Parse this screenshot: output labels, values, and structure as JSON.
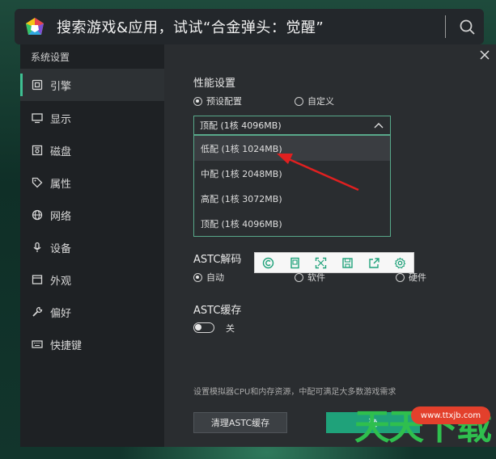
{
  "search": {
    "text": "搜索游戏&应用，试试“合金弹头：觉醒”"
  },
  "dialog": {
    "title": "系统设置"
  },
  "sidebar": {
    "items": [
      {
        "label": "引擎",
        "icon": "cpu-icon",
        "active": true
      },
      {
        "label": "显示",
        "icon": "monitor-icon",
        "active": false
      },
      {
        "label": "磁盘",
        "icon": "disk-icon",
        "active": false
      },
      {
        "label": "属性",
        "icon": "tag-icon",
        "active": false
      },
      {
        "label": "网络",
        "icon": "globe-icon",
        "active": false
      },
      {
        "label": "设备",
        "icon": "microphone-icon",
        "active": false
      },
      {
        "label": "外观",
        "icon": "window-icon",
        "active": false
      },
      {
        "label": "偏好",
        "icon": "wrench-icon",
        "active": false
      },
      {
        "label": "快捷键",
        "icon": "keyboard-icon",
        "active": false
      }
    ]
  },
  "performance": {
    "title": "性能设置",
    "preset_label": "预设配置",
    "custom_label": "自定义",
    "selected": "顶配 (1核 4096MB)",
    "options": [
      "低配 (1核 1024MB)",
      "中配 (1核 2048MB)",
      "高配 (1核 3072MB)",
      "顶配 (1核 4096MB)"
    ]
  },
  "astc_decode": {
    "title": "ASTC解码",
    "auto_label": "自动",
    "software_label": "软件",
    "hardware_label": "硬件"
  },
  "astc_cache": {
    "title": "ASTC缓存",
    "toggle_label": "关",
    "enabled": false
  },
  "hint": "设置模拟器CPU和内存资源，中配可满足大多数游戏需求",
  "buttons": {
    "clear": "清理ASTC缓存",
    "confirm": "确"
  },
  "watermark": {
    "url": "www.ttxjb.com",
    "text": "天天下载"
  },
  "colors": {
    "accent": "#1fa27a",
    "arrow": "#e02020"
  }
}
